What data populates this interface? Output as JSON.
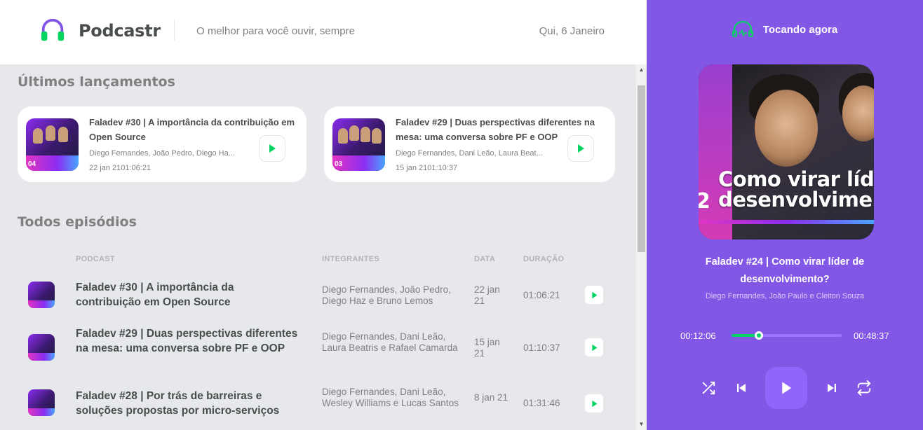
{
  "header": {
    "brand": "Podcastr",
    "tagline": "O melhor para você ouvir, sempre",
    "date": "Qui, 6 Janeiro"
  },
  "latest": {
    "title": "Últimos lançamentos",
    "episodes": [
      {
        "title": "Faladev #30 | A importância da contribuição em Open Source",
        "members": "Diego Fernandes, João Pedro, Diego Ha...",
        "date_duration": "22 jan 2101:06:21",
        "thumb_number": "04"
      },
      {
        "title": "Faladev #29 | Duas perspectivas diferentes na mesa: uma conversa sobre PF e OOP",
        "members": "Diego Fernandes, Dani Leão, Laura Beat...",
        "date_duration": "15 jan 2101:10:37",
        "thumb_number": "03"
      }
    ]
  },
  "all": {
    "title": "Todos episódios",
    "columns": {
      "podcast": "PODCAST",
      "members": "INTEGRANTES",
      "date": "DATA",
      "duration": "DURAÇÃO"
    },
    "rows": [
      {
        "title": "Faladev #30 | A importância da contribuição em Open Source",
        "members": "Diego Fernandes, João Pedro, Diego Haz e Bruno Lemos",
        "date": "22 jan 21",
        "duration": "01:06:21"
      },
      {
        "title": "Faladev #29 | Duas perspectivas diferentes na mesa: uma conversa sobre PF e OOP",
        "members": "Diego Fernandes, Dani Leão, Laura Beatris e Rafael Camarda",
        "date": "15 jan 21",
        "duration": "01:10:37"
      },
      {
        "title": "Faladev #28 | Por trás de barreiras e soluções propostas por micro-serviços",
        "members": "Diego Fernandes, Dani Leão, Wesley Williams e Lucas Santos",
        "date": "8 jan 21",
        "duration": "01:31:46"
      }
    ]
  },
  "player": {
    "header_label": "Tocando agora",
    "cover_text_line1": "Como virar líd",
    "cover_text_line2": "desenvolvime",
    "cover_number": "2",
    "episode_title": "Faladev #24 | Como virar líder de desenvolvimento?",
    "episode_members": "Diego Fernandes, João Paulo e Cleiton Souza",
    "current_time": "00:12:06",
    "total_time": "00:48:37",
    "progress_fraction": 0.25
  },
  "icons": {
    "logo": "headphones-icon",
    "now_playing": "headphones-wave-icon",
    "play": "play-icon",
    "shuffle": "shuffle-icon",
    "previous": "skip-previous-icon",
    "next": "skip-next-icon",
    "repeat": "repeat-icon"
  },
  "colors": {
    "accent_purple": "#8257e5",
    "accent_green": "#04d361",
    "background": "#e6e8eb",
    "text_dark": "#494d4b",
    "text_muted": "#808080"
  }
}
